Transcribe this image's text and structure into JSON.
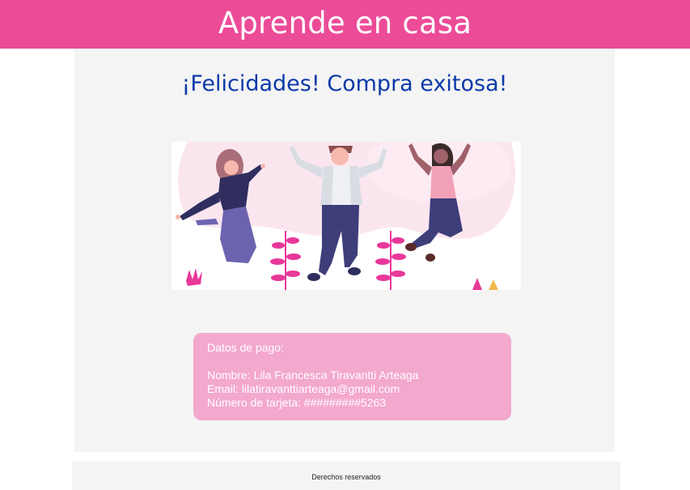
{
  "header": {
    "title": "Aprende en casa"
  },
  "main": {
    "heading": "¡Felicidades! Compra exitosa!",
    "illustration": {
      "icon": "people-jumping-illustration"
    },
    "payment": {
      "title": "Datos de pago:",
      "name_line": "Nombre: Lila Francesca Tiravantti Arteaga",
      "email_line": "Email: lilatiravanttiarteaga@gmail.com",
      "card_line": "Número de tarjeta: #########5263"
    }
  },
  "footer": {
    "text": "Derechos reservados"
  },
  "colors": {
    "header_bg": "#ec4b98",
    "heading": "#0b3aa8",
    "card_bg": "#f3a8cd",
    "panel_bg": "#f4f4f4"
  }
}
